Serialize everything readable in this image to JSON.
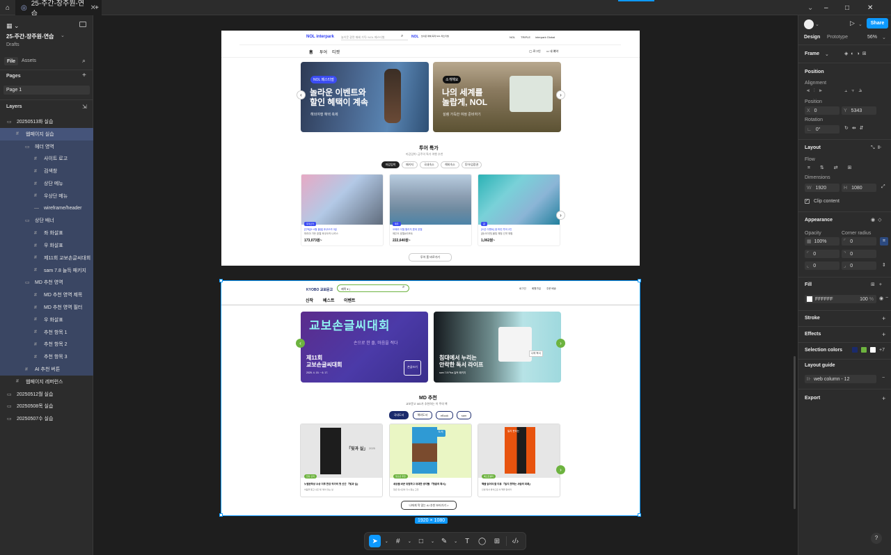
{
  "topbar": {
    "tab_title": "25-주간-장주원-연습",
    "add_tab": "+",
    "win_min": "–",
    "win_max": "□",
    "win_close": "✕"
  },
  "left_panel": {
    "file_title": "25-주간-장주원-연습",
    "drafts": "Drafts",
    "tab_file": "File",
    "tab_assets": "Assets",
    "pages_label": "Pages",
    "page_1": "Page 1",
    "layers_label": "Layers",
    "layers": [
      {
        "label": "20250513화 실습",
        "indent": 0,
        "state": "none",
        "icon": "frame"
      },
      {
        "label": "웹페이지 실습",
        "indent": 1,
        "state": "selh",
        "icon": "grid"
      },
      {
        "label": "헤더 영역",
        "indent": 2,
        "state": "sel",
        "icon": "frame"
      },
      {
        "label": "사이트 로고",
        "indent": 3,
        "state": "sel",
        "icon": "grid"
      },
      {
        "label": "검색창",
        "indent": 3,
        "state": "sel",
        "icon": "grid"
      },
      {
        "label": "상단 메뉴",
        "indent": 3,
        "state": "sel",
        "icon": "grid"
      },
      {
        "label": "우상단 메뉴",
        "indent": 3,
        "state": "sel",
        "icon": "grid"
      },
      {
        "label": "wireframe/header",
        "indent": 3,
        "state": "sel",
        "icon": "line"
      },
      {
        "label": "상단 배너",
        "indent": 2,
        "state": "sel",
        "icon": "frame"
      },
      {
        "label": "좌 화살표",
        "indent": 3,
        "state": "sel",
        "icon": "grid"
      },
      {
        "label": "우 화살표",
        "indent": 3,
        "state": "sel",
        "icon": "grid"
      },
      {
        "label": "제11회 교보손글씨대회",
        "indent": 3,
        "state": "sel",
        "icon": "grid"
      },
      {
        "label": "sam 7.8 늘득 패키지",
        "indent": 3,
        "state": "sel",
        "icon": "grid"
      },
      {
        "label": "MD 추천 영역",
        "indent": 2,
        "state": "sel",
        "icon": "frame"
      },
      {
        "label": "MD 추천 영역 제목",
        "indent": 3,
        "state": "sel",
        "icon": "grid"
      },
      {
        "label": "MD 추천 영역 필터",
        "indent": 3,
        "state": "sel",
        "icon": "grid"
      },
      {
        "label": "우 화살표",
        "indent": 3,
        "state": "sel",
        "icon": "grid"
      },
      {
        "label": "추천 항목 1",
        "indent": 3,
        "state": "sel",
        "icon": "grid"
      },
      {
        "label": "추천 항목 2",
        "indent": 3,
        "state": "sel",
        "icon": "grid"
      },
      {
        "label": "추천 항목 3",
        "indent": 3,
        "state": "sel",
        "icon": "grid"
      },
      {
        "label": "AI 추천 버튼",
        "indent": 2,
        "state": "sel",
        "icon": "grid"
      },
      {
        "label": "웹페이지 레퍼런스",
        "indent": 1,
        "state": "none",
        "icon": "grid"
      },
      {
        "label": "20250512월 실습",
        "indent": 0,
        "state": "none",
        "icon": "frame"
      },
      {
        "label": "20250508목 실습",
        "indent": 0,
        "state": "none",
        "icon": "frame"
      },
      {
        "label": "20250507수 실습",
        "indent": 0,
        "state": "none",
        "icon": "frame"
      }
    ]
  },
  "right_panel": {
    "share": "Share",
    "tab_design": "Design",
    "tab_prototype": "Prototype",
    "zoom": "56%",
    "frame_label": "Frame",
    "position": "Position",
    "alignment": "Alignment",
    "position_sub": "Position",
    "x_label": "X",
    "x_value": "0",
    "y_label": "Y",
    "y_value": "5343",
    "rotation": "Rotation",
    "rotation_value": "0°",
    "layout": "Layout",
    "flow": "Flow",
    "dimensions": "Dimensions",
    "w_label": "W",
    "w_value": "1920",
    "h_label": "H",
    "h_value": "1080",
    "clip_content": "Clip content",
    "appearance": "Appearance",
    "opacity": "Opacity",
    "corner_radius": "Corner radius",
    "opacity_value": "100%",
    "radius_value": "0",
    "fill": "Fill",
    "fill_hex": "FFFFFF",
    "fill_opacity": "100",
    "fill_pct": "%",
    "stroke": "Stroke",
    "effects": "Effects",
    "selection_colors": "Selection colors",
    "sel_more": "+7",
    "layout_guide": "Layout guide",
    "guide_value": "web column - 12",
    "export": "Export",
    "help": "?"
  },
  "canvas": {
    "frame_size_badge": "1920 × 1080",
    "interpark": {
      "logo": "NOL interpark",
      "search_placeholder": "놀이문 광면 매혜 가득! NOL 페스티벌",
      "nol_badge": "NOL",
      "nol_sub": "놀이문 매혜 축제 NOL 페스티벌",
      "top_links": [
        "NOL",
        "TRIPLE",
        "interpark Global"
      ],
      "nav": [
        "홈",
        "투어",
        "티켓"
      ],
      "login": "로그인",
      "my_reserve": "내 예약",
      "banner1_tag": "NOL 페스티벌",
      "banner1_title": "놀라운 이벤트와\n할인 혜택이 계속",
      "banner1_sub": "해외여행 혜택 축제",
      "banner2_tag": "소개해요",
      "banner2_title": "나의 세계를\n놀랍게, NOL",
      "banner2_sub": "설렘 가득한 여정 준비하기",
      "section_title": "투어 특가",
      "section_sub": "마감임박! 금주의 특가 여행 추천",
      "filters": [
        "마감임박",
        "패키지",
        "국내숙소",
        "해외숙소",
        "투어/입장권"
      ],
      "cards": [
        {
          "tag": "후쿠오카",
          "desc": "[단독][5~6월 출발] 후쿠오카 3일",
          "desc2": "마리아 가든 호텔 후쿠오카 나카스",
          "price": "173,073원~"
        },
        {
          "tag": "제주",
          "desc": "오페라 이젤 힐리치 롯데 호텔",
          "desc2": "제주도 호텔&리조트",
          "price": "222,640원~"
        },
        {
          "tag": "괌",
          "desc": "[오픈 이벤트] 괌 마린 투어 2인",
          "desc2": "[괌/사이판] 물빛 체험 선셋 체험",
          "price": "1,062원~"
        }
      ],
      "more_btn": "투어 홈 바로가기"
    },
    "kyobo": {
      "logo": "KYOBO 교보문고",
      "search_select": "제목",
      "top_links": [
        "로그인",
        "회원가입",
        "주문 배송"
      ],
      "nav": [
        "신작",
        "베스트",
        "이벤트"
      ],
      "banner1_art": "교보손글씨대회",
      "banner1_art_sub": "손으로 한 줄, 마음을 적다",
      "banner1_title": "제11회\n교보손글씨대회",
      "banner1_date": "2025. 4. 15. ~ 6. 17.",
      "banner1_btn": "손글쓰기",
      "banner2_title": "침대에서 누리는\n안락한 독서 라이프",
      "banner2_sub": "sam 7.8 Plus 늘득 패키지",
      "banner2_tag": "나의 독서",
      "section_title": "MD 추천",
      "section_sub": "교보문고 MD가 추천하는 이 주의 책",
      "filters": [
        "국내도서",
        "해외도서",
        "eBook",
        "sam"
      ],
      "books": [
        {
          "tag": "한강 신작",
          "cover_text": "「빛과 실」",
          "cover_year": "2025",
          "title": "노벨문학상 수상 이후 한강 작가의 첫 신간 『빛과 실』",
          "desc": "어둠을 뚫고 나온 빛, 빛이 잇는 실"
        },
        {
          "tag": "청소년 추천",
          "cover_text": "도서",
          "cover_year": "",
          "title": "세상을 바꾼 위험하고 위대한 생각들 『청춘의 독서』",
          "desc": "청년 유시민이 다시 읽는 고전"
        },
        {
          "tag": "베스트셀러",
          "cover_text": "잃지 못하는",
          "cover_year": "",
          "title": "책을 읽어야 할 이유 『읽지 못하는 사람의 미래』",
          "desc": "인생 독서 방식으로 이 책을 읽어라"
        }
      ],
      "ai_btn": "나에게 딱 맞는 AI 추천 보러가기 >"
    }
  },
  "colors": {
    "accent": "#0d99ff",
    "selection": "#3a4663",
    "kyobo_green": "#6db33f",
    "kyobo_navy": "#1a2a6c",
    "interpark_blue": "#2c3cf5"
  }
}
